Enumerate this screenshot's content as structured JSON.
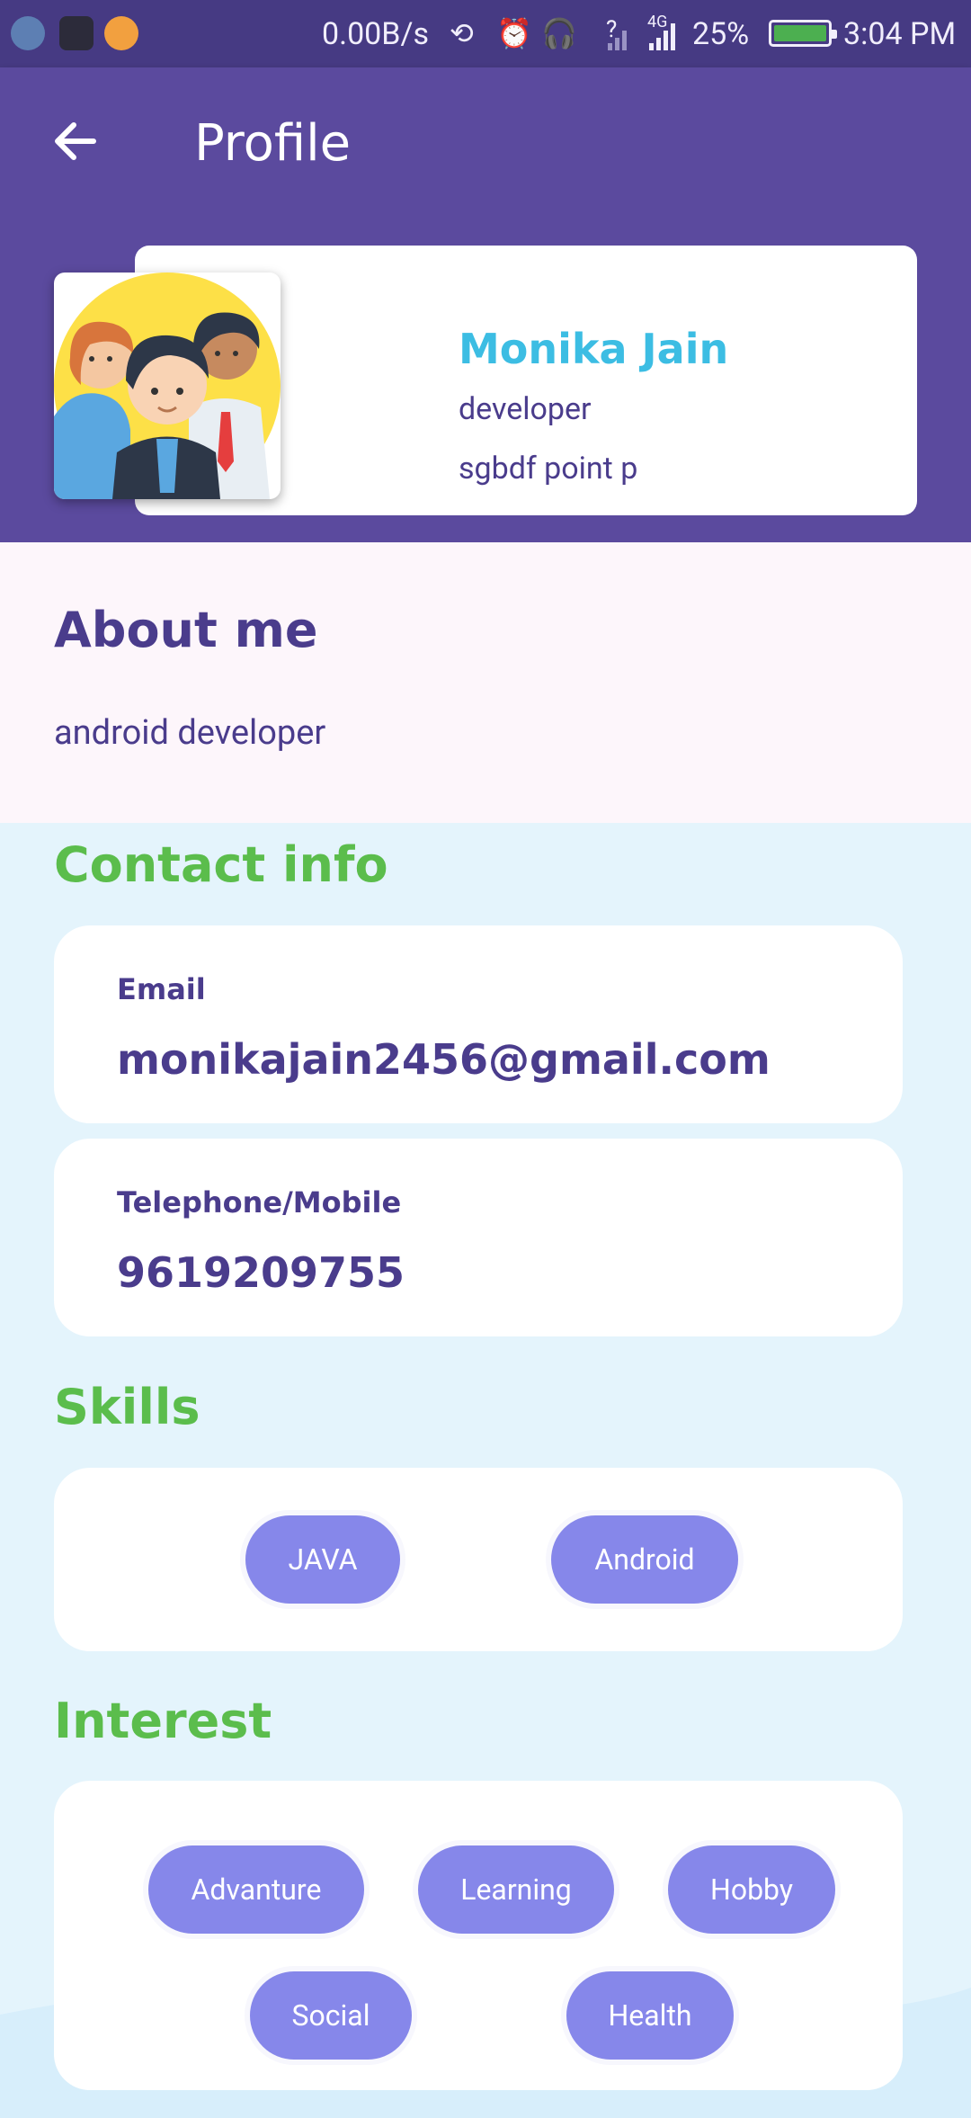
{
  "status_bar": {
    "speed": "0.00B/s",
    "signal_unknown": "?",
    "network_type": "4G",
    "battery": "25%",
    "time": "3:04 PM"
  },
  "app_bar": {
    "title": "Profile"
  },
  "profile": {
    "name": "Monika Jain",
    "role": "developer",
    "company": "sgbdf point p"
  },
  "about": {
    "heading": "About me",
    "text": "android developer"
  },
  "contact": {
    "heading": "Contact info",
    "email_label": "Email",
    "email_value": "monikajain2456@gmail.com",
    "phone_label": "Telephone/Mobile",
    "phone_value": "9619209755"
  },
  "skills": {
    "heading": "Skills",
    "items": [
      "JAVA",
      "Android"
    ]
  },
  "interest": {
    "heading": "Interest",
    "items": [
      "Advanture",
      "Learning",
      "Hobby",
      "Social",
      "Health"
    ]
  },
  "colors": {
    "primary": "#5b4a9e",
    "status_bar": "#463a83",
    "name_accent": "#3cbde3",
    "section_title": "#5bbd4c",
    "chip": "#8687ea",
    "text": "#4a3c8c"
  }
}
